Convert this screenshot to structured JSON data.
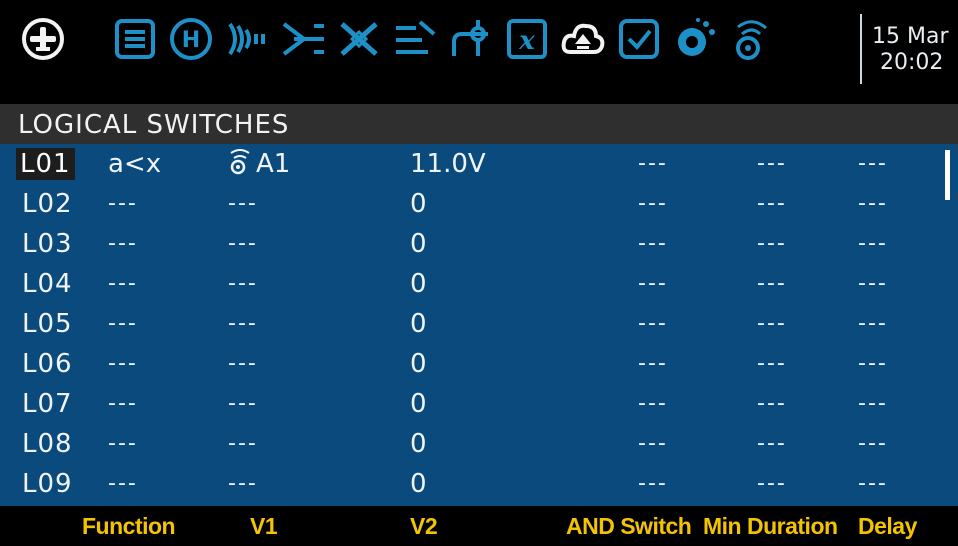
{
  "header": {
    "date": "15 Mar",
    "time": "20:02",
    "icons": [
      "plane-home-icon",
      "list-icon",
      "heli-icon",
      "radio-waves-icon",
      "mixer-icon",
      "cross-icon",
      "curve-icon",
      "output-icon",
      "variable-x-icon",
      "cloud-upload-icon",
      "checklist-icon",
      "telemetry-icon",
      "sensor-icon"
    ]
  },
  "screen": {
    "title": "LOGICAL SWITCHES"
  },
  "rows": [
    {
      "id": "L01",
      "func": "a<x",
      "v1": "A1",
      "v1_icon": "sensor-icon",
      "v2": "11.0V",
      "and": "---",
      "min": "---",
      "delay": "---"
    },
    {
      "id": "L02",
      "func": "---",
      "v1": "---",
      "v2": "0",
      "and": "---",
      "min": "---",
      "delay": "---"
    },
    {
      "id": "L03",
      "func": "---",
      "v1": "---",
      "v2": "0",
      "and": "---",
      "min": "---",
      "delay": "---"
    },
    {
      "id": "L04",
      "func": "---",
      "v1": "---",
      "v2": "0",
      "and": "---",
      "min": "---",
      "delay": "---"
    },
    {
      "id": "L05",
      "func": "---",
      "v1": "---",
      "v2": "0",
      "and": "---",
      "min": "---",
      "delay": "---"
    },
    {
      "id": "L06",
      "func": "---",
      "v1": "---",
      "v2": "0",
      "and": "---",
      "min": "---",
      "delay": "---"
    },
    {
      "id": "L07",
      "func": "---",
      "v1": "---",
      "v2": "0",
      "and": "---",
      "min": "---",
      "delay": "---"
    },
    {
      "id": "L08",
      "func": "---",
      "v1": "---",
      "v2": "0",
      "and": "---",
      "min": "---",
      "delay": "---"
    },
    {
      "id": "L09",
      "func": "---",
      "v1": "---",
      "v2": "0",
      "and": "---",
      "min": "---",
      "delay": "---"
    }
  ],
  "footer": {
    "function": "Function",
    "v1": "V1",
    "v2": "V2",
    "and_switch": "AND Switch",
    "min_duration": "Min Duration",
    "delay": "Delay"
  },
  "colors": {
    "accent": "#1e90c8",
    "list_bg": "#0b4a7d",
    "footer_text": "#f5c400"
  }
}
